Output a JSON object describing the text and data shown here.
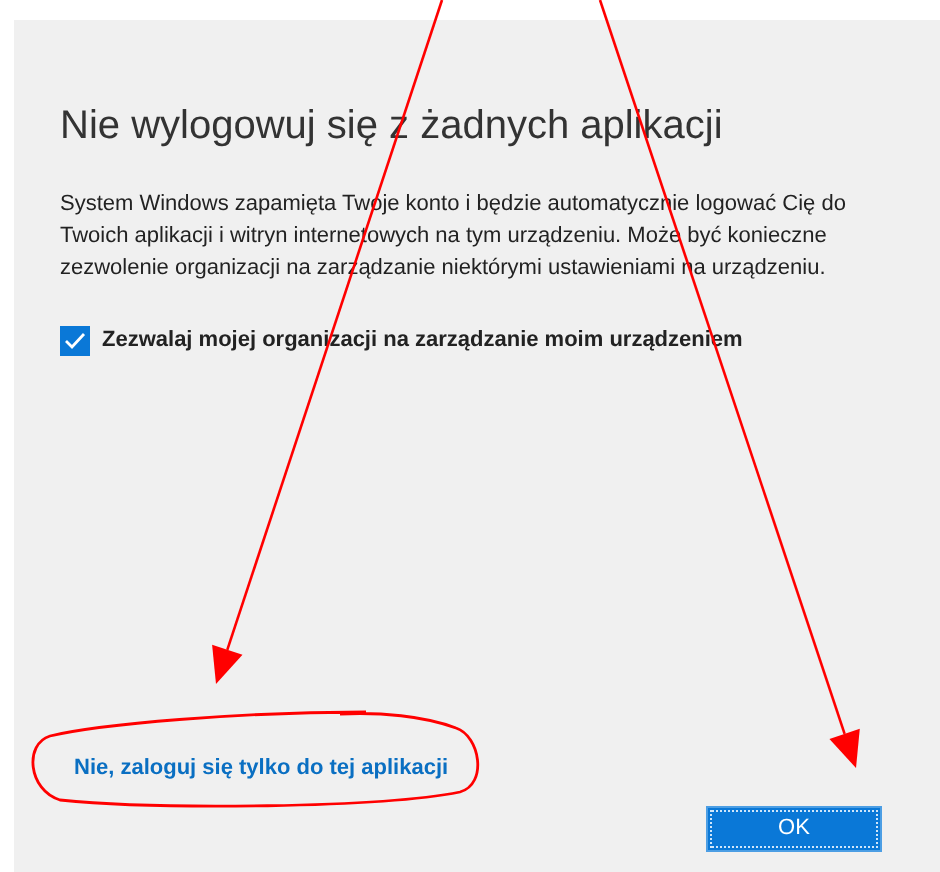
{
  "dialog": {
    "title": "Nie wylogowuj się z żadnych aplikacji",
    "description": "System Windows zapamięta Twoje konto i będzie automatycznie logować Cię do Twoich aplikacji i witryn internetowych na tym urządzeniu. Może być konieczne zezwolenie organizacji na zarządzanie niektórymi ustawieniami na urządzeniu.",
    "checkbox": {
      "label": "Zezwalaj mojej organizacji na zarządzanie moim urządzeniem",
      "checked": true
    },
    "link": "Nie, zaloguj się tylko do tej aplikacji",
    "buttons": [
      "OK"
    ]
  },
  "annotations": [
    {
      "kind": "arrow"
    },
    {
      "kind": "arrow"
    },
    {
      "kind": "ellipse"
    }
  ]
}
